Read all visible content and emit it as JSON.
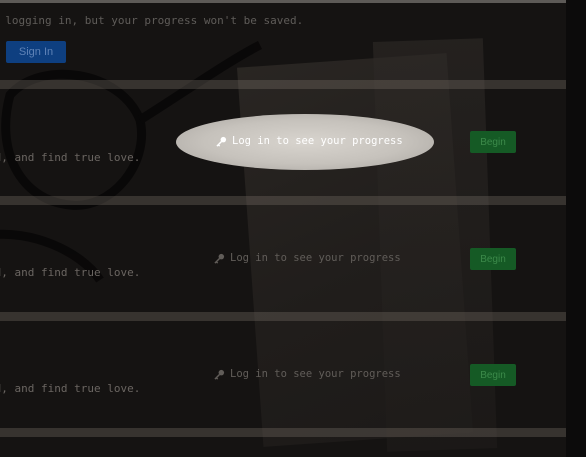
{
  "notice": {
    "text": "t logging in, but your progress won't be saved."
  },
  "signin_label": "Sign In",
  "rows": [
    {
      "desc": "ld, and find true love.",
      "progress": "Log in to see your progress",
      "begin": "Begin"
    },
    {
      "desc": "ld, and find true love.",
      "progress": "Log in to see your progress",
      "begin": "Begin"
    },
    {
      "desc": "ld, and find true love.",
      "progress": "Log in to see your progress",
      "begin": "Begin"
    }
  ],
  "icons": {
    "progress": "key-icon"
  },
  "colors": {
    "begin_button": "#155a25",
    "signin_button": "#0e3f80",
    "highlight": "#d2cec8"
  }
}
